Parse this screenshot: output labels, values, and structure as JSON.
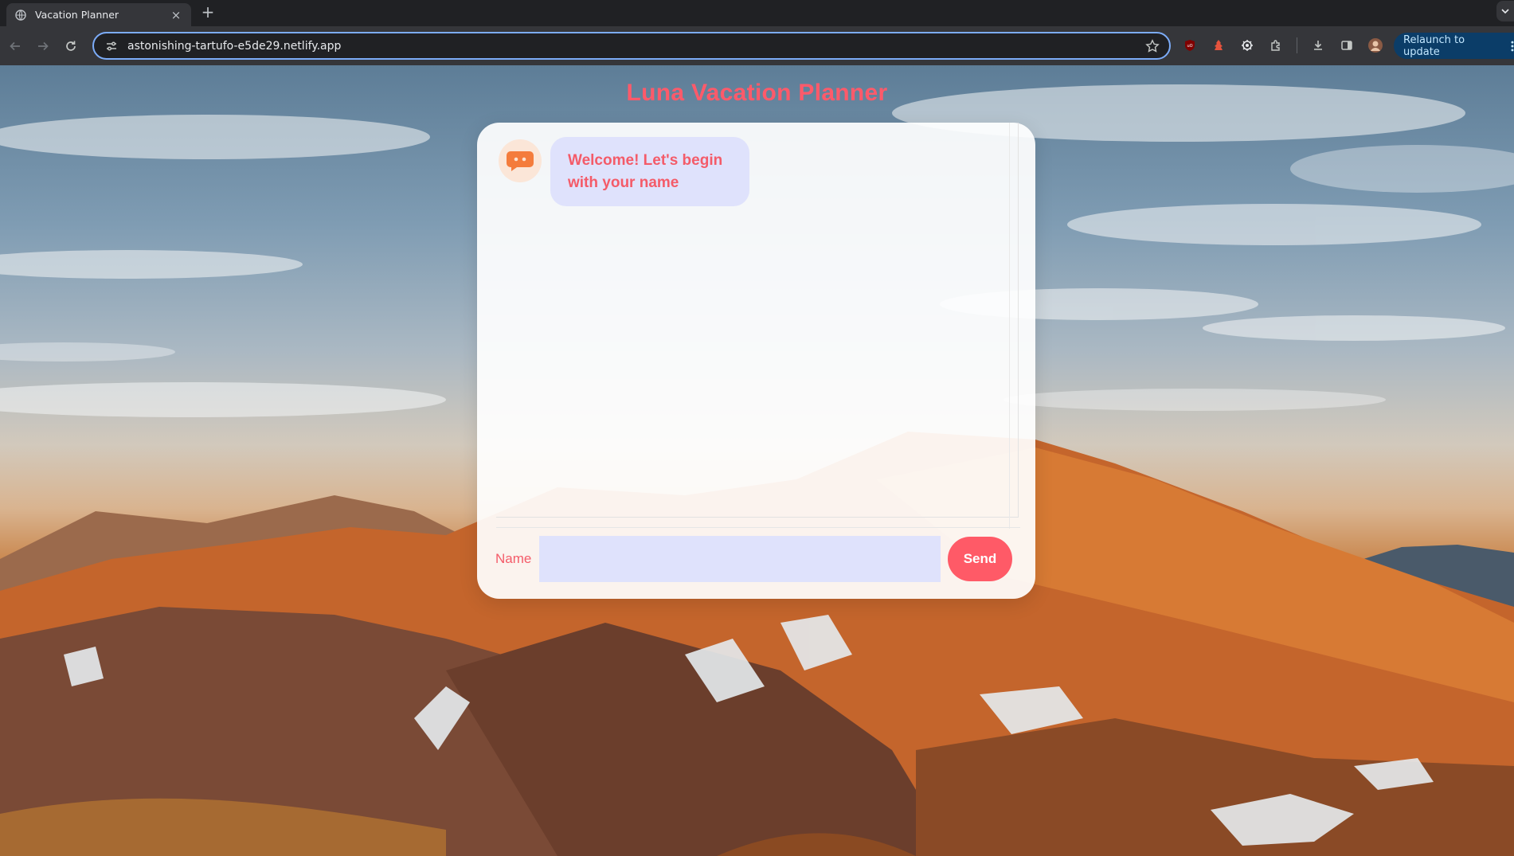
{
  "browser": {
    "tab": {
      "title": "Vacation Planner",
      "favicon": "globe-icon"
    },
    "new_tab_label": "+",
    "close_label": "×",
    "url": "astonishing-tartufo-e5de29.netlify.app",
    "relaunch_label": "Relaunch to update",
    "extensions": [
      "ublock-icon",
      "red-extension-icon",
      "gear-extension-icon",
      "puzzle-icon"
    ],
    "toolbar_icons": [
      "download-icon",
      "side-panel-icon",
      "profile-avatar"
    ]
  },
  "app": {
    "title": "Luna Vacation Planner",
    "messages": [
      {
        "sender": "bot",
        "text": "Welcome! Let's begin with your name"
      }
    ],
    "input": {
      "label": "Name",
      "value": "",
      "placeholder": ""
    },
    "send_label": "Send"
  },
  "colors": {
    "accent": "#ff5a67",
    "bubble": "#dfe2fc",
    "avatar_bg": "#fbe6d8",
    "avatar_icon": "#f47c3c"
  }
}
